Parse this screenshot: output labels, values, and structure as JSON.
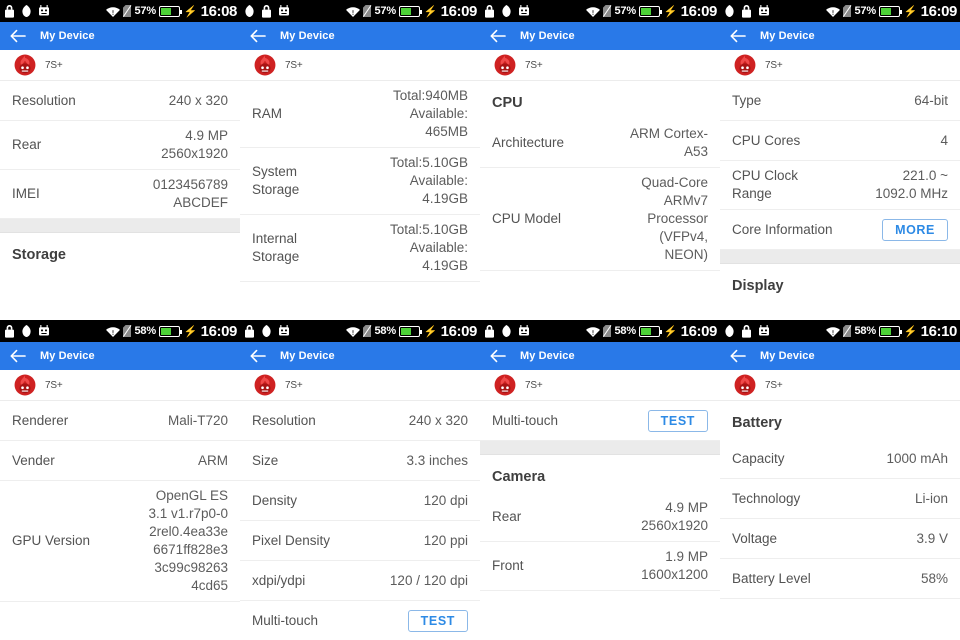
{
  "app": {
    "name": "7S+",
    "toolbar_title": "My Device",
    "logo_icon": "antutu-flame-logo",
    "back_icon": "back-arrow-icon",
    "accent_color": "#2979e8",
    "link_color": "#2d8ae5",
    "section_bg": "#ebebeb"
  },
  "status_icons": {
    "lock": "lock-icon",
    "circle": "shield-circle-icon",
    "robot": "android-robot-icon",
    "wifi": "wifi-icon",
    "signal": "signal-no-sim-icon",
    "battery": "battery-charging-icon"
  },
  "panels": [
    {
      "id": "panel-1",
      "status": {
        "battery_pct": "57%",
        "time": "16:08",
        "icon_order": [
          "lock",
          "circle",
          "robot"
        ]
      },
      "rows": [
        {
          "type": "item",
          "label": "Resolution",
          "value": "240 x 320"
        },
        {
          "type": "item",
          "label": "Rear",
          "value": "4.9 MP\n2560x1920"
        },
        {
          "type": "item",
          "label": "IMEI",
          "value": "0123456789\nABCDEF"
        },
        {
          "type": "gap"
        },
        {
          "type": "head",
          "label": "Storage"
        }
      ]
    },
    {
      "id": "panel-2",
      "status": {
        "battery_pct": "57%",
        "time": "16:09",
        "icon_order": [
          "circle",
          "lock",
          "robot"
        ]
      },
      "rows": [
        {
          "type": "item",
          "label": "RAM",
          "value": "Total:940MB\nAvailable:\n465MB"
        },
        {
          "type": "item",
          "label": "System\nStorage",
          "value": "Total:5.10GB\nAvailable:\n4.19GB"
        },
        {
          "type": "item",
          "label": "Internal\nStorage",
          "value": "Total:5.10GB\nAvailable:\n4.19GB"
        }
      ]
    },
    {
      "id": "panel-3",
      "status": {
        "battery_pct": "57%",
        "time": "16:09",
        "icon_order": [
          "lock",
          "circle",
          "robot"
        ]
      },
      "rows": [
        {
          "type": "head",
          "label": "CPU"
        },
        {
          "type": "item",
          "label": "Architecture",
          "value": "ARM Cortex-\nA53"
        },
        {
          "type": "item",
          "label": "CPU Model",
          "value": "Quad-Core\nARMv7\nProcessor\n(VFPv4,\nNEON)"
        }
      ]
    },
    {
      "id": "panel-4",
      "status": {
        "battery_pct": "57%",
        "time": "16:09",
        "icon_order": [
          "circle",
          "lock",
          "robot"
        ]
      },
      "rows": [
        {
          "type": "item",
          "label": "Type",
          "value": "64-bit"
        },
        {
          "type": "item",
          "label": "CPU Cores",
          "value": "4"
        },
        {
          "type": "item",
          "label": "CPU Clock\nRange",
          "value": "221.0 ~\n1092.0 MHz"
        },
        {
          "type": "button",
          "label": "Core Information",
          "button": "MORE"
        },
        {
          "type": "gap"
        },
        {
          "type": "head",
          "label": "Display"
        }
      ]
    },
    {
      "id": "panel-5",
      "status": {
        "battery_pct": "58%",
        "time": "16:09",
        "icon_order": [
          "lock",
          "circle",
          "robot"
        ]
      },
      "rows": [
        {
          "type": "item",
          "label": "Renderer",
          "value": "Mali-T720"
        },
        {
          "type": "item",
          "label": "Vender",
          "value": "ARM"
        },
        {
          "type": "item",
          "label": "GPU Version",
          "value": "OpenGL ES\n3.1 v1.r7p0-0\n2rel0.4ea33e\n6671ff828e3\n3c99c98263\n4cd65"
        }
      ]
    },
    {
      "id": "panel-6",
      "status": {
        "battery_pct": "58%",
        "time": "16:09",
        "icon_order": [
          "lock",
          "circle",
          "robot"
        ]
      },
      "rows": [
        {
          "type": "item",
          "label": "Resolution",
          "value": "240 x 320"
        },
        {
          "type": "item",
          "label": "Size",
          "value": "3.3 inches"
        },
        {
          "type": "item",
          "label": "Density",
          "value": "120 dpi"
        },
        {
          "type": "item",
          "label": "Pixel Density",
          "value": "120 ppi"
        },
        {
          "type": "item",
          "label": "xdpi/ydpi",
          "value": "120 / 120 dpi"
        },
        {
          "type": "button",
          "label": "Multi-touch",
          "button": "TEST"
        }
      ]
    },
    {
      "id": "panel-7",
      "status": {
        "battery_pct": "58%",
        "time": "16:09",
        "icon_order": [
          "lock",
          "circle",
          "robot"
        ]
      },
      "rows": [
        {
          "type": "button",
          "label": "Multi-touch",
          "button": "TEST"
        },
        {
          "type": "gap"
        },
        {
          "type": "head",
          "label": "Camera"
        },
        {
          "type": "item",
          "label": "Rear",
          "value": "4.9 MP\n2560x1920"
        },
        {
          "type": "item",
          "label": "Front",
          "value": "1.9 MP\n1600x1200"
        }
      ]
    },
    {
      "id": "panel-8",
      "status": {
        "battery_pct": "58%",
        "time": "16:10",
        "icon_order": [
          "circle",
          "lock",
          "robot"
        ]
      },
      "rows": [
        {
          "type": "head",
          "label": "Battery"
        },
        {
          "type": "item",
          "label": "Capacity",
          "value": "1000 mAh"
        },
        {
          "type": "item",
          "label": "Technology",
          "value": "Li-ion"
        },
        {
          "type": "item",
          "label": "Voltage",
          "value": "3.9 V"
        },
        {
          "type": "item",
          "label": "Battery Level",
          "value": "58%"
        }
      ]
    }
  ]
}
